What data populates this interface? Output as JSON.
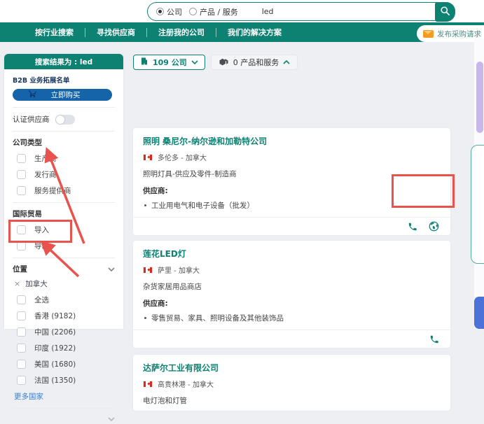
{
  "search": {
    "company_label": "公司",
    "product_label": "产品 / 服务",
    "query": "led"
  },
  "nav": {
    "items": [
      "按行业搜索",
      "寻找供应商",
      "注册我的公司",
      "我们的解决方案"
    ],
    "post_request_label": "发布采购请求"
  },
  "sidebar": {
    "header": "搜索结果为 : led",
    "b2b_label": "B2B 业务拓展名单",
    "buy_button": "立即购买",
    "verified_supplier_label": "认证供应商",
    "company_type": {
      "title": "公司类型",
      "options": [
        "生产商",
        "发行商",
        "服务提供商"
      ]
    },
    "international_trade": {
      "title": "国际贸易",
      "options": [
        "导入",
        "导出"
      ]
    },
    "location": {
      "title": "位置",
      "selected_tag": "加拿大",
      "remove_symbol": "×",
      "options": [
        "全选",
        "香港 (9182)",
        "中国 (2206)",
        "印度 (1922)",
        "美国 (1680)",
        "法国 (1350)"
      ],
      "more_link": "更多国家"
    }
  },
  "results": {
    "companies_tab": "109 公司",
    "products_tab": "0 产品和服务",
    "cards": [
      {
        "name": "照明 桑尼尔-纳尔逊和加勒特公司",
        "location": "多伦多 - 加拿大",
        "category": "照明灯具-供应及零件-制造商",
        "supplier_label": "供应商:",
        "supplier_item": "工业用电气和电子设备（批发）"
      },
      {
        "name": "莲花LED灯",
        "location": "萨里 - 加拿大",
        "category": "杂货家居用品商店",
        "supplier_label": "供应商:",
        "supplier_item": "零售贸易、家具、照明设备及其他装饰品"
      },
      {
        "name": "达萨尔工业有限公司",
        "location": "高贵林港 - 加拿大",
        "category": "电灯泡和灯管"
      }
    ]
  },
  "colors": {
    "teal": "#0d8172",
    "blue_button": "#1563a8",
    "link_blue": "#3c7fd0",
    "annotation_red": "#e8534e",
    "envelope_orange": "#f59b22",
    "flag_red": "#d52b1e"
  }
}
